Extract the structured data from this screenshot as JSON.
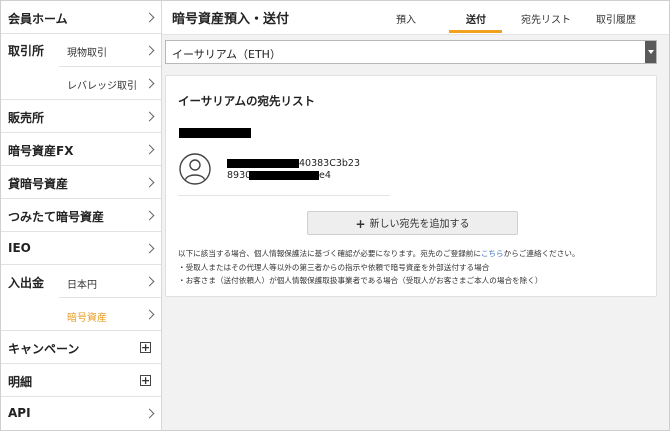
{
  "sidebar": {
    "items": [
      {
        "label": "会員ホーム",
        "control": "chevron"
      },
      {
        "label": "取引所",
        "control": "none",
        "subitems": [
          {
            "label": "現物取引"
          },
          {
            "label": "レバレッジ取引"
          }
        ]
      },
      {
        "label": "販売所",
        "control": "chevron"
      },
      {
        "label": "暗号資産FX",
        "control": "chevron"
      },
      {
        "label": "貸暗号資産",
        "control": "chevron"
      },
      {
        "label": "つみたて暗号資産",
        "control": "chevron"
      },
      {
        "label": "IEO",
        "control": "chevron"
      },
      {
        "label": "入出金",
        "control": "none",
        "subitems": [
          {
            "label": "日本円"
          },
          {
            "label": "暗号資産",
            "active": true
          }
        ]
      },
      {
        "label": "キャンペーン",
        "control": "plus"
      },
      {
        "label": "明細",
        "control": "plus"
      },
      {
        "label": "API",
        "control": "chevron"
      }
    ]
  },
  "header": {
    "title": "暗号資産預入・送付",
    "tabs": [
      {
        "label": "預入"
      },
      {
        "label": "送付",
        "active": true
      },
      {
        "label": "宛先リスト"
      },
      {
        "label": "取引履歴"
      }
    ]
  },
  "currency_select": {
    "value": "イーサリアム（ETH）"
  },
  "card": {
    "title": "イーサリアムの宛先リスト",
    "address_line1_visible": "40383C3b23",
    "address_line2_prefix": "8930",
    "address_line2_suffix": "e4",
    "add_button_label": "新しい宛先を追加する",
    "notes": {
      "line1_before": "以下に該当する場合、個人情報保護法に基づく確認が必要になります。宛先のご登録前に",
      "line1_link": "こちら",
      "line1_after": "からご連絡ください。",
      "line2": "・受取人またはその代理人等以外の第三者からの指示や依頼で暗号資産を外部送付する場合",
      "line3": "・お客さま（送付依頼人）が個人情報保護取扱事業者である場合（受取人がお客さまご本人の場合を除く）"
    }
  },
  "colors": {
    "accent": "#f0a21e",
    "active_sub": "#e89a1e",
    "link": "#3b6fc4"
  }
}
